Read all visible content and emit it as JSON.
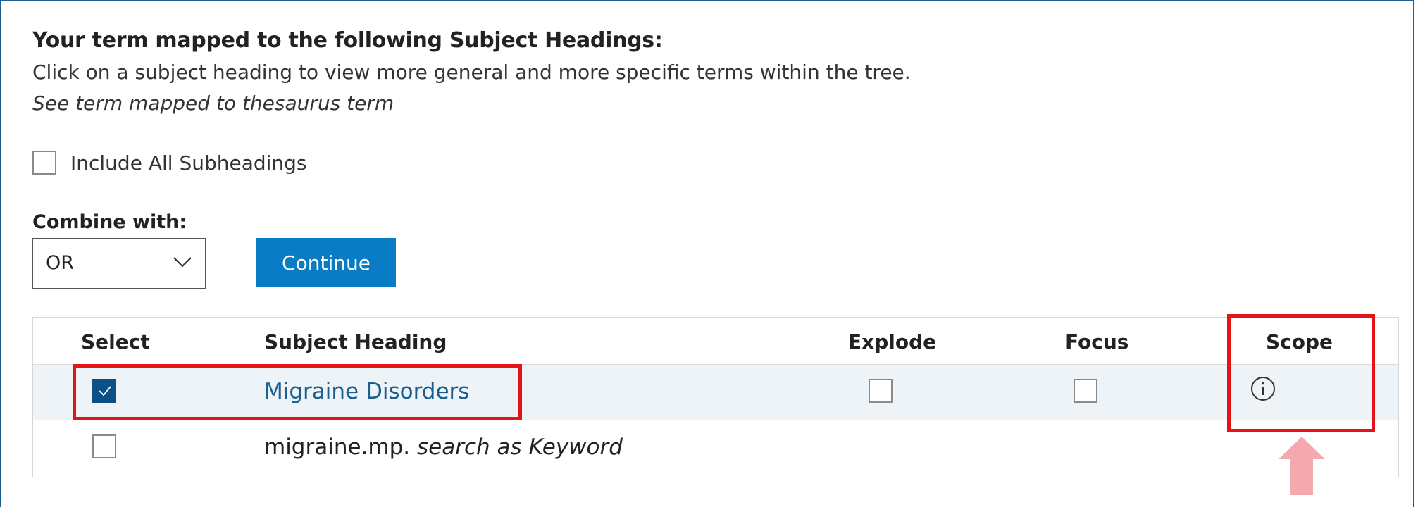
{
  "header": {
    "title": "Your term mapped to the following Subject Headings:",
    "instructions": "Click on a subject heading to view more general and more specific terms within the tree.",
    "see_term_link": "See term mapped to thesaurus term"
  },
  "options": {
    "include_all_subheadings_label": "Include All Subheadings",
    "include_all_subheadings_checked": false,
    "combine_label": "Combine with:",
    "combine_value": "OR",
    "continue_label": "Continue"
  },
  "table": {
    "columns": [
      "Select",
      "Subject Heading",
      "Explode",
      "Focus",
      "Scope"
    ],
    "rows": [
      {
        "selected": true,
        "heading": "Migraine Disorders",
        "explode": false,
        "focus": false,
        "scope_icon": "info-icon"
      },
      {
        "selected": false,
        "term": "migraine.mp.",
        "term_suffix": "search as Keyword"
      }
    ]
  },
  "colors": {
    "accent": "#0a7bc5",
    "link": "#1a5e8e",
    "checked": "#0a4f86",
    "highlight_row": "#eef3f7",
    "callout": "#e3131a",
    "arrow": "#f4a9b0",
    "border": "#1f5f8f"
  }
}
